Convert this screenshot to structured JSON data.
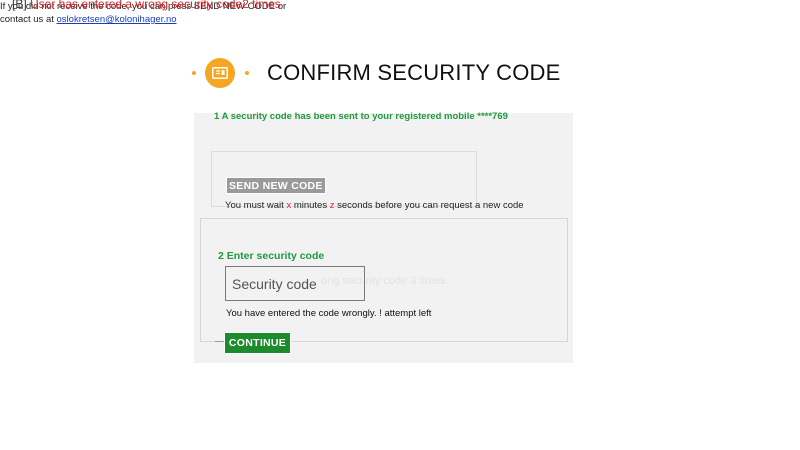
{
  "note": {
    "prefix": "[B]",
    "text": "User has entered a wrong security code2 times"
  },
  "header": {
    "title": "CONFIRM SECURITY CODE",
    "icon": "id-card-icon",
    "accent_color": "#f5a623"
  },
  "step1": {
    "label": "1  A security code has been sent to your registered mobile ****769",
    "info_line1": "If you did not receive the code, you can press SEND NEW CODE or",
    "info_line2_prefix": "contact us at",
    "email": "oslokretsen@kolonihager.no",
    "send_button": "SEND NEW CODE",
    "wait": {
      "part1": "You must wait",
      "x": "x",
      "part2": "minutes",
      "z": "z",
      "part3": "seconds before you can request a new code"
    }
  },
  "step2": {
    "label": "2  Enter security code",
    "input_placeholder": "Security code",
    "ghost_text": "ong security code 3 times.",
    "error": "You have entered the code wrongly. ! attempt left",
    "continue_button": "CONTINUE"
  },
  "colors": {
    "green": "#1f9a3c",
    "red": "#d9262c",
    "panel": "#f2f2f2",
    "continue": "#1d8a2c"
  }
}
